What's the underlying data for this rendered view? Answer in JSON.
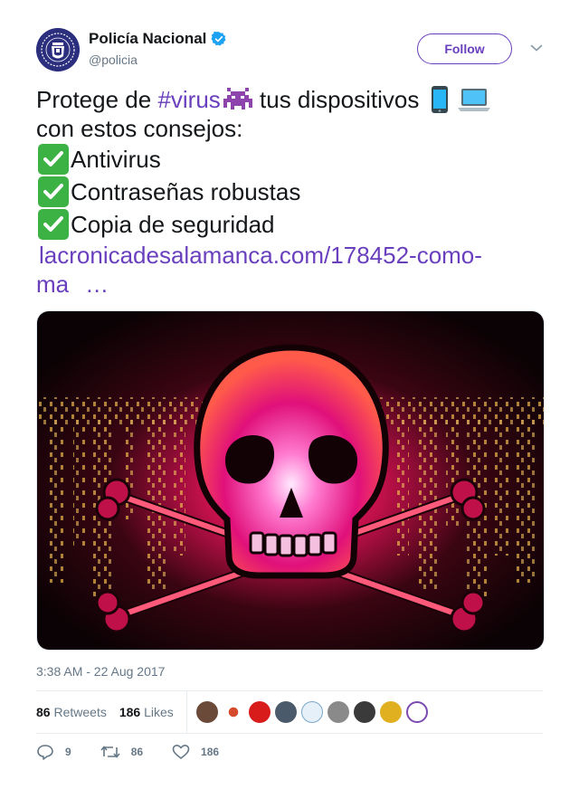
{
  "author": {
    "display_name": "Policía Nacional",
    "handle": "@policia",
    "verified": true,
    "avatar_icon": "police-badge-icon",
    "avatar_color": "#2b2f7e"
  },
  "follow_label": "Follow",
  "accent_color": "#6a3fbd",
  "tweet": {
    "prefix": "Protege de ",
    "hashtag": "#virus",
    "after_hashtag": " tus dispositivos",
    "line2": "con estos consejos:",
    "tips": [
      "Antivirus",
      "Contraseñas robustas",
      "Copia de seguridad"
    ],
    "link_part1": "lacronicadesalamanca.com/178452-como-",
    "link_part2": "ma",
    "ellipsis": "…",
    "emojis": [
      "space-invader-emoji",
      "mobile-phone-emoji",
      "laptop-emoji",
      "check-mark-emoji"
    ]
  },
  "media": {
    "icon": "skull-crossbones-image",
    "description_color": "#e0107a"
  },
  "timestamp": "3:38 AM - 22 Aug 2017",
  "stats": {
    "retweets_count": "86",
    "retweets_label": "Retweets",
    "likes_count": "186",
    "likes_label": "Likes"
  },
  "likers_colors": [
    "#6b4a3a",
    "#d64b2b",
    "#d81b1b",
    "#4b5a6a",
    "#7aa7c9",
    "#8a8a8a",
    "#3a3a3a",
    "#e0b020",
    "#7a4ab0"
  ],
  "actions": {
    "reply_count": "9",
    "retweet_count": "86",
    "like_count": "186"
  }
}
